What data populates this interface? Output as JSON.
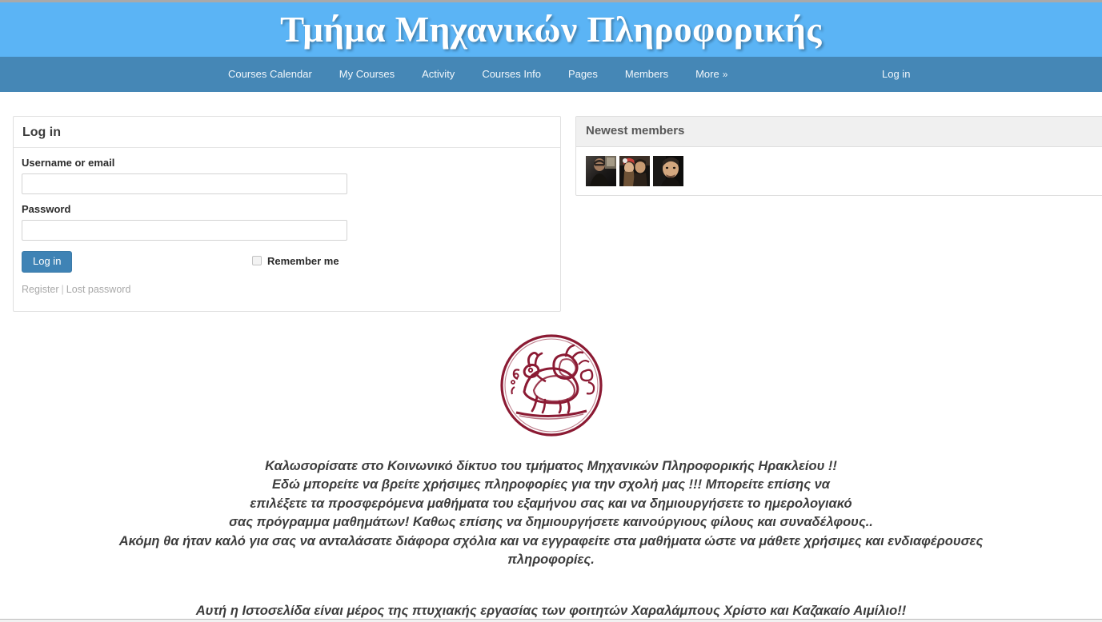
{
  "site": {
    "title": "Τμήμα Μηχανικών Πληροφορικής",
    "banner_color": "#5bb4f5",
    "nav_color": "#4587b6"
  },
  "nav": {
    "items": [
      {
        "label": "Courses Calendar",
        "name": "courses-calendar"
      },
      {
        "label": "My Courses",
        "name": "my-courses"
      },
      {
        "label": "Activity",
        "name": "activity"
      },
      {
        "label": "Courses Info",
        "name": "courses-info"
      },
      {
        "label": "Pages",
        "name": "pages"
      },
      {
        "label": "Members",
        "name": "members"
      }
    ],
    "more_label": "More",
    "more_chevron": "»",
    "login_label": "Log in"
  },
  "login_form": {
    "title": "Log in",
    "username_label": "Username or email",
    "username_value": "",
    "username_placeholder": "",
    "password_label": "Password",
    "password_value": "",
    "password_placeholder": "",
    "submit_label": "Log in",
    "remember_label": "Remember me",
    "remember_checked": false,
    "register_label": "Register",
    "separator": "|",
    "lost_password_label": "Lost password",
    "button_color": "#3f83b5"
  },
  "newest_members": {
    "title": "Newest members",
    "avatars": [
      {
        "name": "member-avatar-1"
      },
      {
        "name": "member-avatar-2"
      },
      {
        "name": "member-avatar-3"
      }
    ]
  },
  "seal": {
    "alt": "TEI of Crete department seal",
    "color": "#8b1a33"
  },
  "welcome": {
    "lines": [
      "Καλωσορίσατε στο Κοινωνικό δίκτυο του τμήματος Μηχανικών Πληροφορικής Ηρακλείου !!",
      "Εδώ μπορείτε να βρείτε χρήσιμες πληροφορίες για την σχολή μας !!! Μπορείτε επίσης να",
      "επιλέξετε τα προσφερόμενα μαθήματα του εξαμήνου σας και να δημιουργήσετε το ημερολογιακό",
      "σας πρόγραμμα μαθημάτων! Καθως επίσης να δημιουργήσετε καινούργιους φίλους και συναδέλφους..",
      "Ακόμη θα ήταν καλό για σας να ανταλάσατε διάφορα σχόλια και να εγγραφείτε στα μαθήματα ώστε να μάθετε χρήσιμες και ενδιαφέρουσες",
      "πληροφορίες."
    ]
  },
  "credit": {
    "text": "Αυτή η Ιστοσελίδα είναι μέρος της πτυχιακής εργασίας των φοιτητών Χαραλάμπους Χρίστο και Καζακαίο Αιμίλιο!!"
  }
}
